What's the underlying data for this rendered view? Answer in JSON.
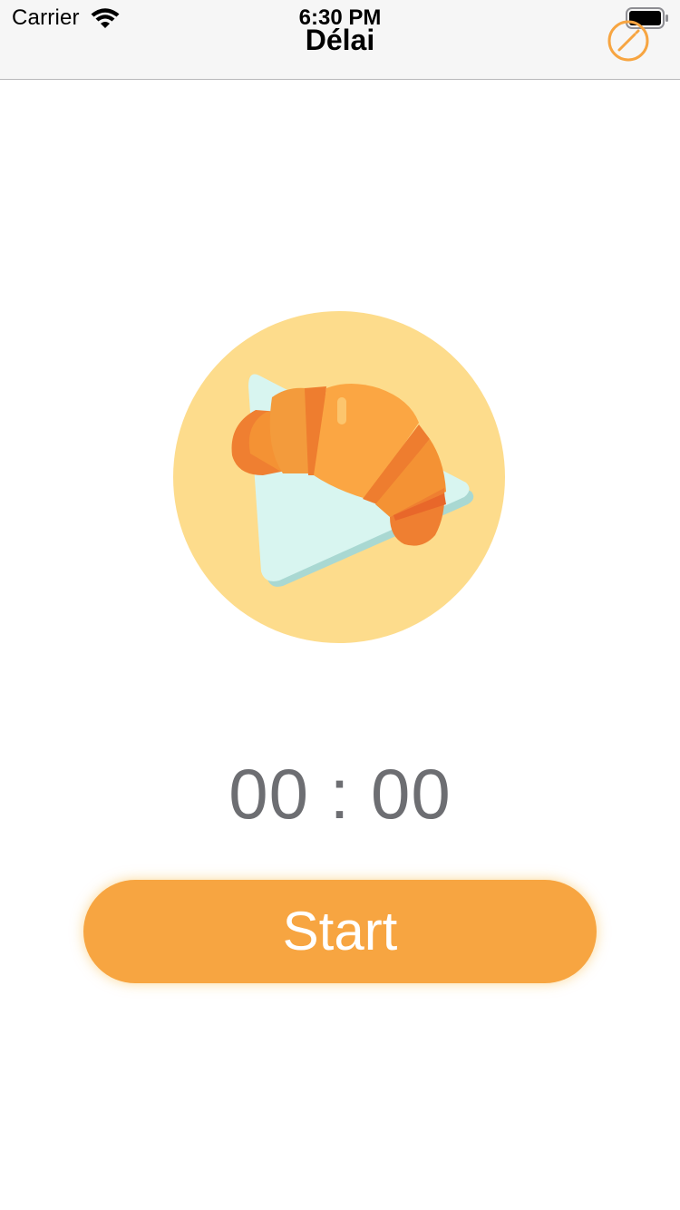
{
  "status_bar": {
    "carrier": "Carrier",
    "time": "6:30 PM",
    "wifi_icon": "wifi-icon",
    "battery_icon": "battery-full-icon"
  },
  "nav": {
    "title": "Délai",
    "right_button_icon": "pencil-circle-icon"
  },
  "illustration": {
    "subject": "croissant-icon",
    "background_color": "#fddc8c"
  },
  "timer": {
    "display": "00 : 00"
  },
  "actions": {
    "start_label": "Start"
  },
  "colors": {
    "accent": "#f7a541",
    "timer_text": "#6d6e72"
  }
}
